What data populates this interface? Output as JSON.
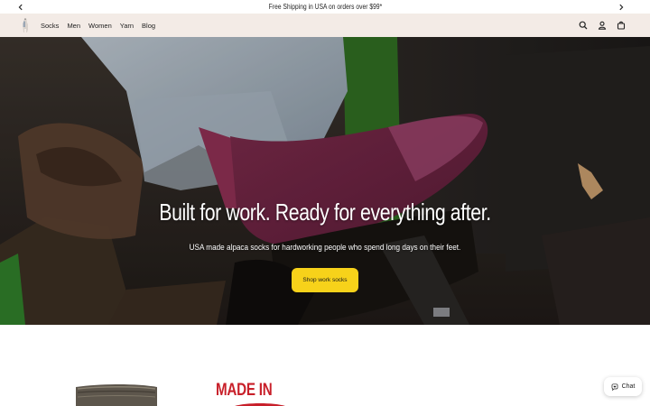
{
  "announcement": {
    "text": "Free Shipping in USA on orders over $99*",
    "prev_icon": "chevron-left-icon",
    "next_icon": "chevron-right-icon"
  },
  "header": {
    "logo_icon": "alpaca-logo-icon",
    "nav": [
      "Socks",
      "Men",
      "Women",
      "Yarn",
      "Blog"
    ],
    "icons": [
      "search-icon",
      "account-icon",
      "cart-icon"
    ]
  },
  "hero": {
    "title": "Built for work. Ready for everything after.",
    "subtitle": "USA made alpaca socks for hardworking people who spend long days on their feet.",
    "cta": "Shop work socks"
  },
  "below": {
    "made_in_text": "MADE IN"
  },
  "chat": {
    "label": "Chat",
    "icon": "chat-heart-icon"
  },
  "colors": {
    "header_bg": "#f3ebe6",
    "cta_bg": "#f7d21a",
    "made_in_red": "#c8202a"
  }
}
